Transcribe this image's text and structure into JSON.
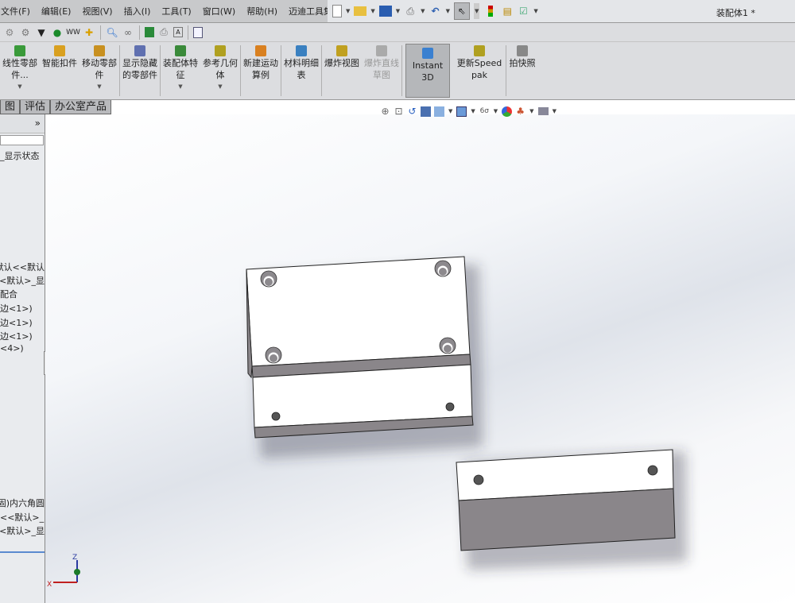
{
  "menu": [
    "文件(F)",
    "编辑(E)",
    "视图(V)",
    "插入(I)",
    "工具(T)",
    "窗口(W)",
    "帮助(H)",
    "迈迪工具集"
  ],
  "title": "装配体1 *",
  "ribbon": [
    {
      "label": "线性零部件...",
      "icon": "linear-pattern-icon",
      "arrow": true
    },
    {
      "label": "智能扣件",
      "icon": "smart-fastener-icon"
    },
    {
      "label": "移动零部件",
      "icon": "move-component-icon",
      "arrow": true
    },
    {
      "label": "显示隐藏的零部件",
      "icon": "show-hidden-icon"
    },
    {
      "label": "装配体特征",
      "icon": "assembly-feature-icon",
      "arrow": true
    },
    {
      "label": "参考几何体",
      "icon": "reference-geometry-icon",
      "arrow": true
    },
    {
      "label": "新建运动算例",
      "icon": "motion-study-icon"
    },
    {
      "label": "材料明细表",
      "icon": "bom-icon"
    },
    {
      "label": "爆炸视图",
      "icon": "exploded-view-icon"
    },
    {
      "label": "爆炸直线草图",
      "icon": "explode-line-sketch-icon",
      "disabled": true
    },
    {
      "label": "Instant3D",
      "icon": "instant3d-icon",
      "active": true
    },
    {
      "label": "更新Speedpak",
      "icon": "speedpak-icon"
    },
    {
      "label": "拍快照",
      "icon": "snapshot-icon"
    }
  ],
  "tabs": [
    "图",
    "评估",
    "办公室产品"
  ],
  "panel": {
    "expand": "»",
    "items": [
      "_显示状态",
      "默认<<默认",
      "<默认>_显",
      "配合",
      "边<1>)",
      "边<1>)",
      "边<1>)",
      "<4>)",
      "固)内六角圆",
      "<<默认>_",
      "<默认>_显"
    ]
  },
  "triad": {
    "z": "Z",
    "x": "X"
  },
  "colors": {
    "face": "#ffffff",
    "side": "#8a868a",
    "edge": "#222222",
    "menubar": "#c8c9cb"
  }
}
